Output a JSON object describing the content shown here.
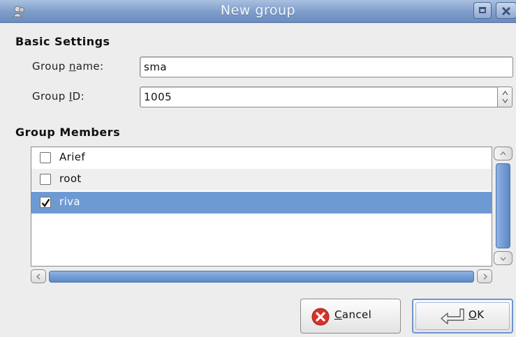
{
  "window": {
    "title": "New group"
  },
  "basic_settings": {
    "title": "Basic Settings",
    "group_name_label_pre": "Group ",
    "group_name_label_mnemonic": "n",
    "group_name_label_post": "ame:",
    "group_name_value": "sma",
    "group_id_label_pre": "Group ",
    "group_id_label_mnemonic": "I",
    "group_id_label_post": "D:",
    "group_id_value": "1005"
  },
  "members": {
    "title": "Group Members",
    "items": [
      {
        "name": "Arief",
        "checked": false
      },
      {
        "name": "root",
        "checked": false
      },
      {
        "name": "riva",
        "checked": true
      }
    ]
  },
  "buttons": {
    "cancel_mnemonic": "C",
    "cancel_rest": "ancel",
    "ok_mnemonic": "O",
    "ok_rest": "K"
  },
  "colors": {
    "titlebar": "#7d9cc9",
    "selection": "#6e9ad4"
  },
  "icons": [
    "group-icon",
    "maximize-icon",
    "close-icon",
    "checkmark-icon",
    "cancel-icon",
    "ok-icon",
    "spin-up-icon",
    "spin-down-icon",
    "scroll-up-icon",
    "scroll-down-icon",
    "scroll-left-icon",
    "scroll-right-icon"
  ]
}
